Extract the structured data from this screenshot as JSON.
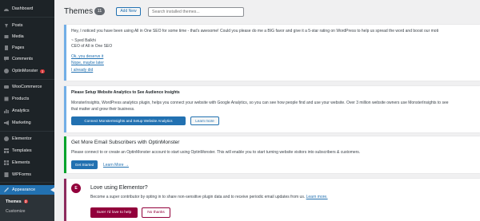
{
  "sidebar": {
    "items": [
      {
        "label": "Dashboard",
        "icon": "dashboard-icon"
      },
      {
        "label": "Posts",
        "icon": "pin-icon"
      },
      {
        "label": "Media",
        "icon": "media-icon"
      },
      {
        "label": "Pages",
        "icon": "page-icon"
      },
      {
        "label": "Comments",
        "icon": "comment-icon"
      },
      {
        "label": "OptinMonster",
        "icon": "optinmonster-icon",
        "badge": "1"
      },
      {
        "label": "WooCommerce",
        "icon": "woocommerce-icon"
      },
      {
        "label": "Products",
        "icon": "products-icon"
      },
      {
        "label": "Analytics",
        "icon": "analytics-icon"
      },
      {
        "label": "Marketing",
        "icon": "megaphone-icon"
      },
      {
        "label": "Elementor",
        "icon": "elementor-icon"
      },
      {
        "label": "Templates",
        "icon": "templates-icon"
      },
      {
        "label": "Elements",
        "icon": "elements-icon"
      },
      {
        "label": "WPForms",
        "icon": "wpforms-icon"
      },
      {
        "label": "Appearance",
        "icon": "brush-icon"
      }
    ],
    "submenu": [
      {
        "label": "Themes",
        "badge": "2"
      },
      {
        "label": "Customize"
      }
    ]
  },
  "header": {
    "title": "Themes",
    "count": "11",
    "add_new": "Add New",
    "search_placeholder": "Search installed themes..."
  },
  "notice_aioseo": {
    "message": "Hey, I noticed you have been using All in One SEO for some time - that's awesome! Could you please do me a BIG favor and give it a 5-star rating on WordPress to help us spread the word and boost our moti",
    "signature": "~ Syed Balkhi",
    "signature_title": "CEO of All in One SEO",
    "links": [
      "Ok, you deserve it",
      "Nope, maybe later",
      "I already did"
    ]
  },
  "notice_monsterinsights": {
    "title": "Please Setup Website Analytics to See Audience Insights",
    "body_line1": "MonsterInsights, WordPress analytics plugin, helps you connect your website with Google Analytics, so you can see how people find and use your website. Over 3 million website owners use MonsterInsights to see",
    "body_line2": "that matter and grow their business.",
    "primary_button": "Connect MonsterInsights and Setup Website Analytics",
    "secondary_button": "Learn more"
  },
  "notice_optinmonster": {
    "title": "Get More Email Subscribers with OptinMonster",
    "body": "Please connect to or create an OptinMonster account to start using OptinMonster. This will enable you to start turning website visitors into subscribers & customers.",
    "primary_button": "Get Started",
    "learn_more": "Learn More →"
  },
  "notice_elementor": {
    "logo": "E",
    "title": "Love using Elementor?",
    "body": "Become a super contributor by opting in to share non-sensitive plugin data and to receive periodic email updates from us.",
    "learn_more": "Learn more.",
    "primary_button": "Sure! I'd love to help",
    "secondary_button": "No thanks"
  },
  "colors": {
    "sidebar_bg": "#1d2327",
    "accent": "#2271b1",
    "green_border": "#00a32a",
    "elementor": "#92003b",
    "badge": "#d63638"
  }
}
